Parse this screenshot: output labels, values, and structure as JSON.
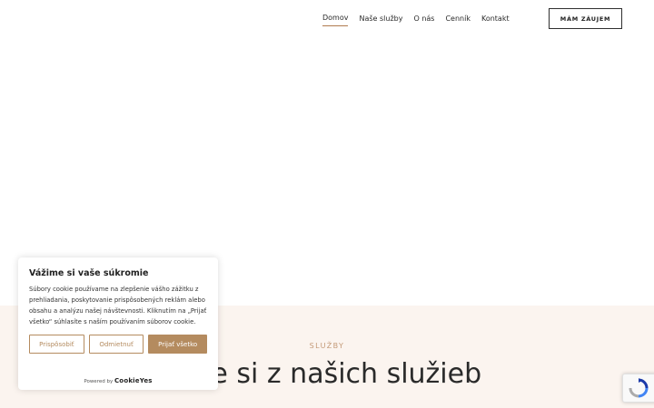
{
  "nav": {
    "items": [
      {
        "label": "Domov",
        "active": true
      },
      {
        "label": "Naše služby"
      },
      {
        "label": "O nás"
      },
      {
        "label": "Cenník"
      },
      {
        "label": "Kontakt"
      }
    ],
    "cta_label": "MÁM ZÁUJEM"
  },
  "services": {
    "label": "SLUŽBY",
    "heading": "erte si z našich služieb"
  },
  "cookie": {
    "title": "Vážime si vaše súkromie",
    "text": "Súbory cookie používame na zlepšenie vášho zážitku z prehliadania, poskytovanie prispôsobených reklám alebo obsahu a analýzu našej návštevnosti. Kliknutím na „Prijať všetko“ súhlasíte s naším používaním súborov cookie.",
    "buttons": {
      "customize": "Prispôsobiť",
      "reject": "Odmietnuť",
      "accept": "Prijať všetko"
    },
    "powered_by": "Powered by",
    "brand": "CookieYes"
  },
  "colors": {
    "accent": "#b48b5f",
    "services_bg": "#fbf4ef",
    "label": "#c49a78"
  },
  "icons": {
    "recaptcha": "recaptcha-icon"
  }
}
